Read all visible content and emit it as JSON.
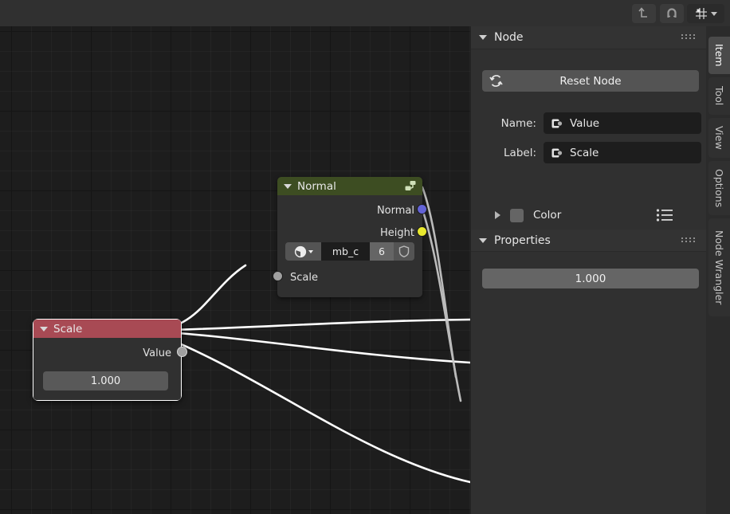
{
  "topbar": {
    "buttons": [
      {
        "name": "parent-up",
        "icon": "arrow-up-hook-icon",
        "active": false
      },
      {
        "name": "snap-magnet",
        "icon": "magnet-icon",
        "active": false
      },
      {
        "name": "snap-target",
        "icon": "snap-grid-icon",
        "active": false
      }
    ]
  },
  "editor": {
    "nodes": [
      {
        "id": "normal",
        "title": "Normal",
        "header_color": "#3d4d22",
        "selected": false,
        "header_icon": "node-group-icon",
        "outputs": [
          {
            "label": "Normal",
            "socket_color": "#6363d6"
          },
          {
            "label": "Height",
            "socket_color": "#e8e82e"
          }
        ],
        "texture": {
          "browse_icon": "texture-browse-icon",
          "name": "mb_c",
          "users": "6",
          "fake_user_icon": "shield-icon"
        },
        "inputs": [
          {
            "label": "Scale",
            "socket_color": "#9f9f9f"
          }
        ]
      },
      {
        "id": "scale",
        "title": "Scale",
        "header_color": "#a84a54",
        "selected": true,
        "outputs": [
          {
            "label": "Value",
            "socket_color": "#9f9f9f"
          }
        ],
        "value": "1.000"
      }
    ]
  },
  "sidebar": {
    "panels": [
      {
        "title": "Node",
        "expanded": true,
        "reset_label": "Reset Node",
        "reset_icon": "refresh-icon",
        "fields": [
          {
            "label": "Name:",
            "value": "Value",
            "icon": "node-socket-icon"
          },
          {
            "label": "Label:",
            "value": "Scale",
            "icon": "node-socket-icon"
          }
        ],
        "color_row": {
          "label": "Color",
          "expanded": false,
          "swatch": "#656565",
          "list_icon": "list-icon"
        }
      },
      {
        "title": "Properties",
        "expanded": true,
        "value": "1.000"
      }
    ]
  },
  "tabs": [
    {
      "label": "Item",
      "active": true
    },
    {
      "label": "Tool",
      "active": false
    },
    {
      "label": "View",
      "active": false
    },
    {
      "label": "Options",
      "active": false
    },
    {
      "label": "Node Wrangler",
      "active": false
    }
  ]
}
